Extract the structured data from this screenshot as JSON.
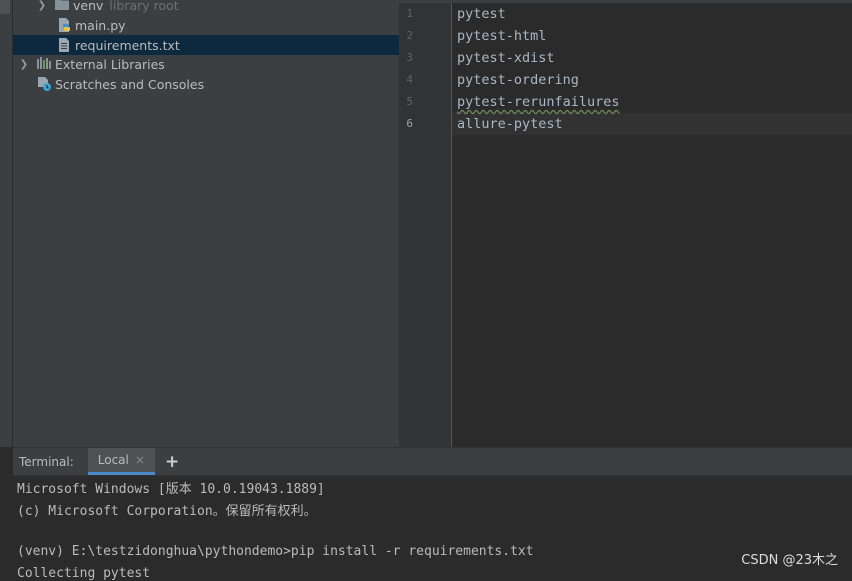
{
  "project_tree": {
    "items": [
      {
        "label": "venv",
        "note": "library root"
      },
      {
        "label": "main.py"
      },
      {
        "label": "requirements.txt"
      },
      {
        "label": "External Libraries"
      },
      {
        "label": "Scratches and Consoles"
      }
    ]
  },
  "editor": {
    "line_numbers": [
      "1",
      "2",
      "3",
      "4",
      "5",
      "6"
    ],
    "lines": [
      "pytest",
      "pytest-html",
      "pytest-xdist",
      "pytest-ordering",
      "pytest-rerunfailures",
      "allure-pytest"
    ]
  },
  "terminal": {
    "label": "Terminal:",
    "tab_label": "Local",
    "close_glyph": "×",
    "add_glyph": "+",
    "lines": [
      "Microsoft Windows [版本 10.0.19043.1889]",
      "(c) Microsoft Corporation。保留所有权利。",
      "",
      "(venv) E:\\testzidonghua\\pythondemo>pip install -r requirements.txt",
      "Collecting pytest"
    ]
  },
  "watermark": "CSDN @23木之",
  "colors": {
    "selection": "#0d293e",
    "folder": "#87939a",
    "python_blue": "#4a8fc9",
    "python_yellow": "#e9c54a",
    "tab_underline": "#4a88c7"
  }
}
